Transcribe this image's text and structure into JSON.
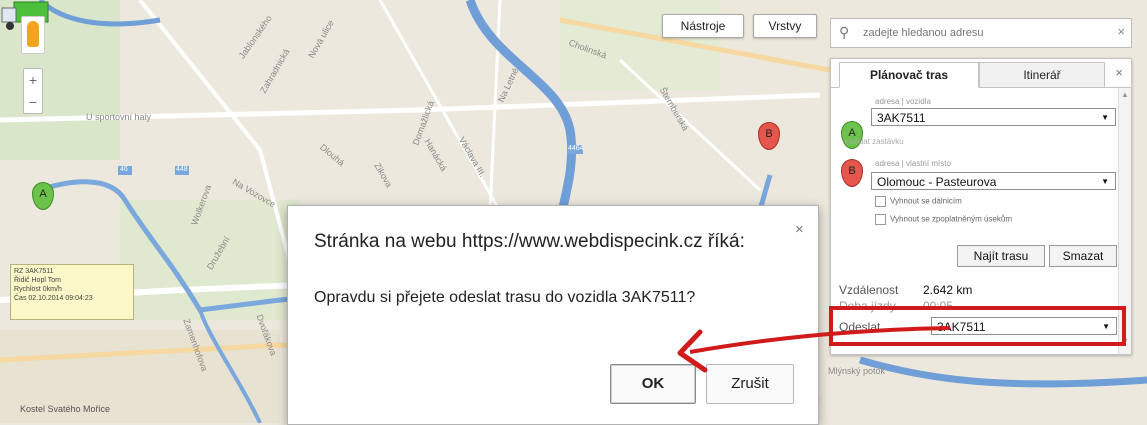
{
  "map": {
    "streets": [
      {
        "id": "s1",
        "text": "Jablonského"
      },
      {
        "id": "s2",
        "text": "Zahradnická"
      },
      {
        "id": "s3",
        "text": "Nová ulice"
      },
      {
        "id": "s4",
        "text": "U sportovní haly"
      },
      {
        "id": "s5",
        "text": "Na Letné"
      },
      {
        "id": "s6",
        "text": "Domažlická"
      },
      {
        "id": "s7",
        "text": "Cholinská"
      },
      {
        "id": "s8",
        "text": "Na Vozovce"
      },
      {
        "id": "s9",
        "text": "Wolkerova"
      },
      {
        "id": "s10",
        "text": "Družební"
      },
      {
        "id": "s11",
        "text": "Dlouhá"
      },
      {
        "id": "s12",
        "text": "Šternberská"
      },
      {
        "id": "s13",
        "text": "Hanácká"
      },
      {
        "id": "s14",
        "text": "Václava III."
      },
      {
        "id": "s15",
        "text": "Zikova"
      },
      {
        "id": "s16",
        "text": "Dvořákova"
      },
      {
        "id": "s17",
        "text": "Zamenhofova"
      },
      {
        "id": "s18",
        "text": "Kostel Svatého Mořice"
      },
      {
        "id": "s19",
        "text": "Mlýnský potok"
      }
    ],
    "road_badges": [
      "46",
      "448",
      "448",
      "4464"
    ],
    "marker_a_label": "A",
    "marker_b_label": "B",
    "vehicle_info": {
      "line1": "RZ 3AK7511",
      "line2": "Řidič Hopl Tom",
      "line3": "Rychlost 0km/h",
      "line4": "Čas 02.10.2014 09:04:23"
    }
  },
  "zoom": {
    "plus": "+",
    "minus": "−"
  },
  "toolbar": {
    "tools_label": "Nástroje",
    "layers_label": "Vrstvy"
  },
  "search": {
    "placeholder": "zadejte hledanou adresu",
    "close": "×"
  },
  "planner": {
    "tab_planner": "Plánovač tras",
    "tab_itinerary": "Itinerář",
    "tab_close": "×",
    "start_caption": "adresa | vozidla",
    "start_value": "3AK7511",
    "add_stop": "+ přidat zastávku",
    "end_caption": "adresa | vlastní místo",
    "end_value": "Olomouc - Pasteurova",
    "avoid_tolls": "Vyhnout se dálnicím",
    "avoid_paid": "Vyhnout se zpoplatněným úsekům",
    "find_route": "Najít trasu",
    "delete": "Smazat",
    "distance_label": "Vzdálenost",
    "distance_value": "2.642 km",
    "time_label": "Doba jízdy",
    "time_value": "00:05",
    "send_label": "Odeslat",
    "send_value": "3AK7511"
  },
  "dialog": {
    "title": "Stránka na webu https://www.webdispecink.cz říká:",
    "close": "×",
    "message": "Opravdu si přejete odeslat trasu do vozidla 3AK7511?",
    "ok_label": "OK",
    "cancel_label": "Zrušit"
  },
  "colors": {
    "route": "#7aa7dc",
    "river": "#6f9fd6",
    "highlight": "#d11a1a",
    "marker_a": "#6cc24a",
    "marker_b": "#e5574d"
  }
}
